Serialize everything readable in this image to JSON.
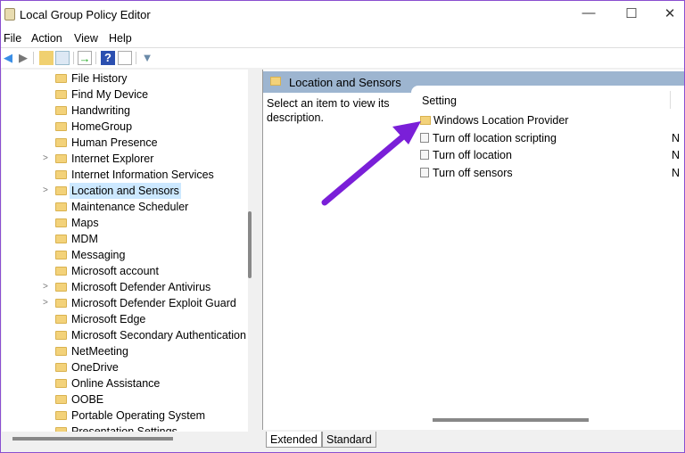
{
  "window": {
    "title": "Local Group Policy Editor",
    "minimize": "—",
    "maximize": "☐",
    "close": "✕"
  },
  "menu": [
    "File",
    "Action",
    "View",
    "Help"
  ],
  "tree": [
    {
      "label": "File History",
      "expandable": false
    },
    {
      "label": "Find My Device",
      "expandable": false
    },
    {
      "label": "Handwriting",
      "expandable": false
    },
    {
      "label": "HomeGroup",
      "expandable": false
    },
    {
      "label": "Human Presence",
      "expandable": false
    },
    {
      "label": "Internet Explorer",
      "expandable": true
    },
    {
      "label": "Internet Information Services",
      "expandable": false
    },
    {
      "label": "Location and Sensors",
      "expandable": true,
      "selected": true
    },
    {
      "label": "Maintenance Scheduler",
      "expandable": false
    },
    {
      "label": "Maps",
      "expandable": false
    },
    {
      "label": "MDM",
      "expandable": false
    },
    {
      "label": "Messaging",
      "expandable": false
    },
    {
      "label": "Microsoft account",
      "expandable": false
    },
    {
      "label": "Microsoft Defender Antivirus",
      "expandable": true
    },
    {
      "label": "Microsoft Defender Exploit Guard",
      "expandable": true
    },
    {
      "label": "Microsoft Edge",
      "expandable": false
    },
    {
      "label": "Microsoft Secondary Authentication",
      "expandable": false
    },
    {
      "label": "NetMeeting",
      "expandable": false
    },
    {
      "label": "OneDrive",
      "expandable": false
    },
    {
      "label": "Online Assistance",
      "expandable": false
    },
    {
      "label": "OOBE",
      "expandable": false
    },
    {
      "label": "Portable Operating System",
      "expandable": false
    },
    {
      "label": "Presentation Settings",
      "expandable": false
    }
  ],
  "right": {
    "header": "Location and Sensors",
    "description": "Select an item to view its description.",
    "column": "Setting",
    "rows": [
      {
        "label": "Windows Location Provider",
        "type": "folder",
        "state": ""
      },
      {
        "label": "Turn off location scripting",
        "type": "setting",
        "state": "N"
      },
      {
        "label": "Turn off location",
        "type": "setting",
        "state": "N"
      },
      {
        "label": "Turn off sensors",
        "type": "setting",
        "state": "N"
      }
    ]
  },
  "tabs": [
    "Extended",
    "Standard"
  ],
  "annotation_color": "#7a1fd8"
}
